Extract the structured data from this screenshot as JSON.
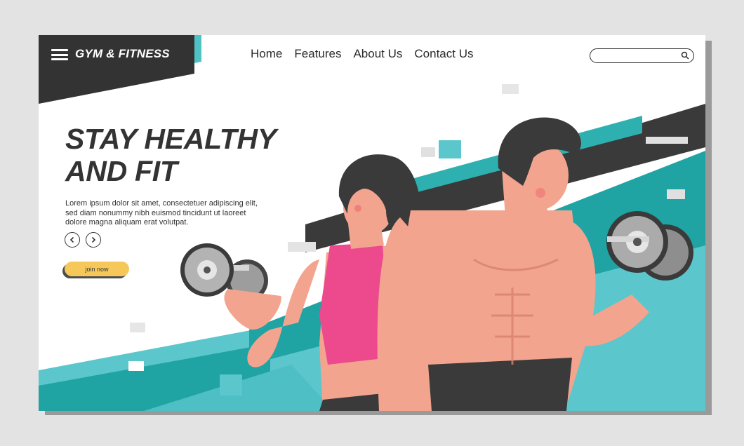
{
  "header": {
    "brand": "GYM & FITNESS",
    "menu_icon": "hamburger-menu-icon",
    "nav": [
      {
        "label": "Home"
      },
      {
        "label": "Features"
      },
      {
        "label": "About Us"
      },
      {
        "label": "Contact Us"
      }
    ],
    "search": {
      "placeholder": "",
      "icon": "search-icon"
    }
  },
  "hero": {
    "title_line1": "STAY HEALTHY",
    "title_line2": "AND FIT",
    "body": "Lorem ipsum dolor sit amet, consectetuer adipiscing elit, sed diam nonummy nibh euismod tincidunt ut laoreet dolore magna aliquam erat volutpat.",
    "prev_icon": "chevron-left-icon",
    "next_icon": "chevron-right-icon",
    "cta_label": "join now"
  },
  "colors": {
    "dark": "#333333",
    "teal": "#1fa8a8",
    "light_teal": "#5cc6cb",
    "cta": "#f6c85a",
    "sports_bra": "#ec4a8c",
    "skin": "#f2a48f"
  },
  "illustration": {
    "subject": "woman-and-man-lifting-dumbbells"
  }
}
